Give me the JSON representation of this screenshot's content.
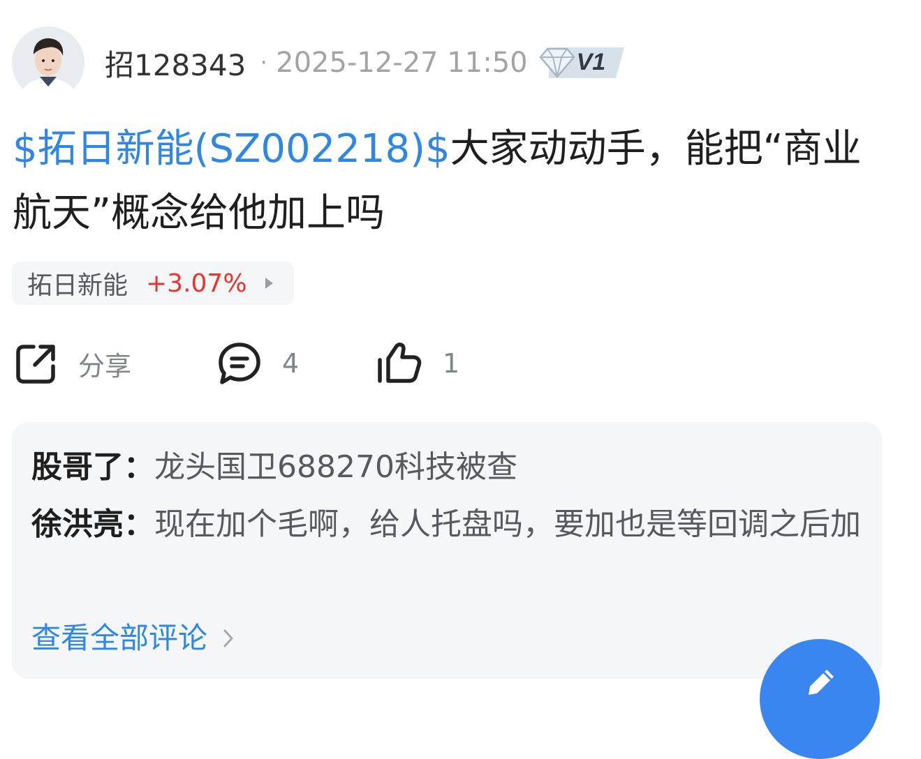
{
  "header": {
    "username": "招128343",
    "separator": "·",
    "timestamp": "2025-12-27 11:50",
    "level_badge": "V1"
  },
  "post": {
    "stock_tag": "$拓日新能(SZ002218)$",
    "text": "大家动动手，能把“商业航天”概念给他加上吗"
  },
  "stock_chip": {
    "name": "拓日新能",
    "change": "+3.07%",
    "change_color": "#e8342e"
  },
  "actions": {
    "share_label": "分享",
    "comment_count": "4",
    "like_count": "1"
  },
  "comments": [
    {
      "author": "股哥了：",
      "text": "龙头国卫688270科技被查"
    },
    {
      "author": "徐洪亮：",
      "text": "现在加个毛啊，给人托盘吗，要加也是等回调之后加"
    }
  ],
  "view_all_comments": "查看全部评论",
  "colors": {
    "link": "#2f87e3",
    "up": "#e8342e",
    "fab": "#3a86f0"
  },
  "icons": {
    "share": "share-icon",
    "comment": "comment-icon",
    "like": "thumbs-up-icon",
    "edit": "pencil-icon",
    "badge": "diamond-icon"
  }
}
